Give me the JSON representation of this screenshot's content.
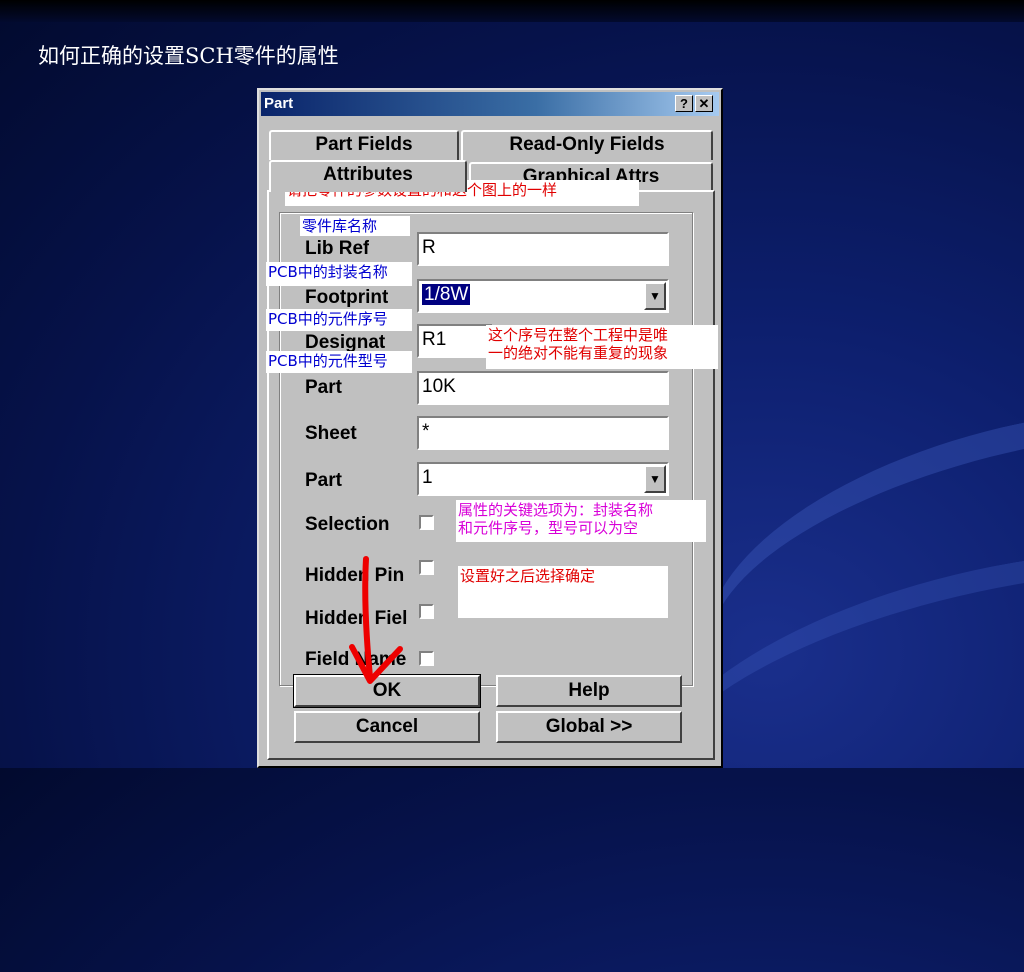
{
  "slide": {
    "title": "如何正确的设置SCH零件的属性"
  },
  "dialog": {
    "title": "Part",
    "help_btn": "?",
    "close_btn": "✕",
    "tabs": {
      "part_fields": "Part Fields",
      "read_only": "Read-Only Fields",
      "attributes": "Attributes",
      "graphical": "Graphical Attrs"
    },
    "labels": {
      "lib_ref": "Lib Ref",
      "footprint": "Footprint",
      "designator": "Designat",
      "part_type": "Part",
      "sheet": "Sheet",
      "part": "Part",
      "selection": "Selection",
      "hidden_pins": "Hidden Pin",
      "hidden_fields": "Hidden Fiel",
      "field_names": "Field Name"
    },
    "values": {
      "lib_ref": "R",
      "footprint": "1/8W",
      "designator": "R1",
      "part_type": "10K",
      "sheet": "*",
      "part": "1"
    },
    "buttons": {
      "ok": "OK",
      "help": "Help",
      "cancel": "Cancel",
      "global": "Global >>"
    }
  },
  "annotations": {
    "header": "请把零件的参数设置的和这个图上的一样",
    "lib_name": "零件库名称",
    "pcb_footprint": "PCB中的封装名称",
    "pcb_designator": "PCB中的元件序号",
    "pcb_part_type": "PCB中的元件型号",
    "unique_line1": "这个序号在整个工程中是唯",
    "unique_line2": "一的绝对不能有重复的现象",
    "key_line1": "属性的关键选项为：封装名称",
    "key_line2": "和元件序号，型号可以为空",
    "confirm": "设置好之后选择确定"
  },
  "colors": {
    "annotation_red": "#e00000",
    "annotation_blue": "#0000d0",
    "annotation_magenta": "#d800d8",
    "dialog_gray": "#c0c0c0",
    "titlebar_blue": "#0a246a"
  }
}
